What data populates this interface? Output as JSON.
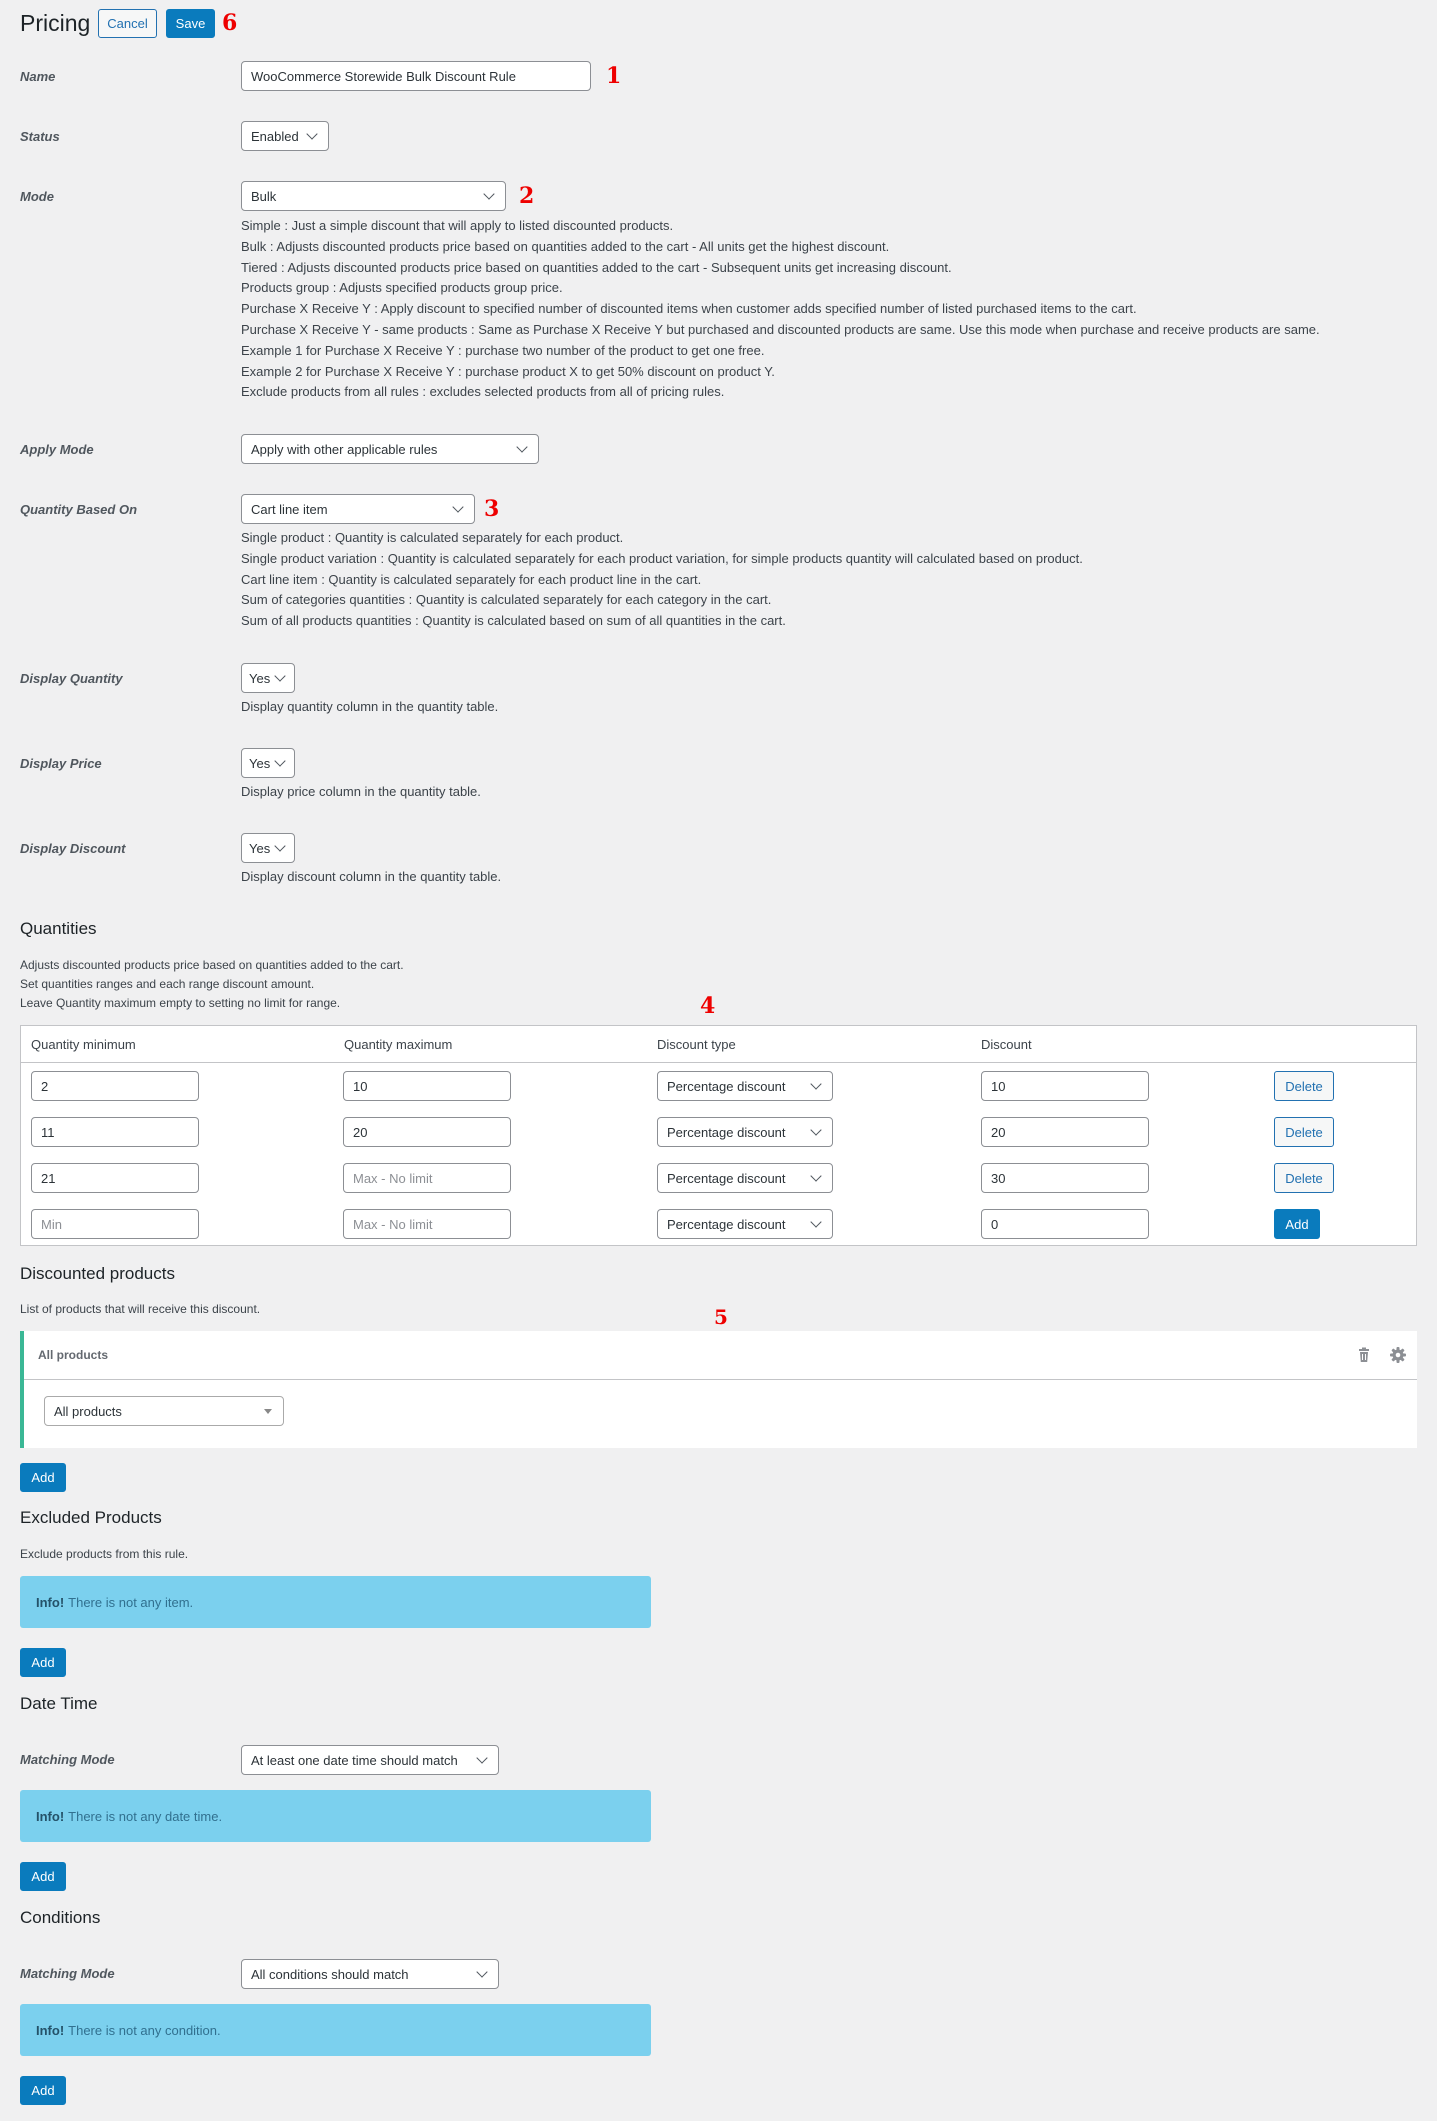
{
  "header": {
    "title": "Pricing",
    "cancel_label": "Cancel",
    "save_label": "Save",
    "annotation": "6"
  },
  "fields": {
    "name": {
      "label": "Name",
      "value": "WooCommerce Storewide Bulk Discount Rule",
      "annotation": "1"
    },
    "status": {
      "label": "Status",
      "value": "Enabled"
    },
    "mode": {
      "label": "Mode",
      "value": "Bulk",
      "annotation": "2",
      "descriptions": [
        "Simple : Just a simple discount that will apply to listed discounted products.",
        "Bulk : Adjusts discounted products price based on quantities added to the cart - All units get the highest discount.",
        "Tiered : Adjusts discounted products price based on quantities added to the cart - Subsequent units get increasing discount.",
        "Products group : Adjusts specified products group price.",
        "Purchase X Receive Y : Apply discount to specified number of discounted items when customer adds specified number of listed purchased items to the cart.",
        "Purchase X Receive Y - same products : Same as Purchase X Receive Y but purchased and discounted products are same. Use this mode when purchase and receive products are same.",
        "Example 1 for Purchase X Receive Y : purchase two number of the product to get one free.",
        "Example 2 for Purchase X Receive Y : purchase product X to get 50% discount on product Y.",
        "Exclude products from all rules : excludes selected products from all of pricing rules."
      ]
    },
    "apply_mode": {
      "label": "Apply Mode",
      "value": "Apply with other applicable rules"
    },
    "quantity_based_on": {
      "label": "Quantity Based On",
      "value": "Cart line item",
      "annotation": "3",
      "descriptions": [
        "Single product : Quantity is calculated separately for each product.",
        "Single product variation : Quantity is calculated separately for each product variation, for simple products quantity will calculated based on product.",
        "Cart line item : Quantity is calculated separately for each product line in the cart.",
        "Sum of categories quantities : Quantity is calculated separately for each category in the cart.",
        "Sum of all products quantities : Quantity is calculated based on sum of all quantities in the cart."
      ]
    },
    "display_quantity": {
      "label": "Display Quantity",
      "value": "Yes",
      "description": "Display quantity column in the quantity table."
    },
    "display_price": {
      "label": "Display Price",
      "value": "Yes",
      "description": "Display price column in the quantity table."
    },
    "display_discount": {
      "label": "Display Discount",
      "value": "Yes",
      "description": "Display discount column in the quantity table."
    }
  },
  "quantities": {
    "title": "Quantities",
    "descriptions": [
      "Adjusts discounted products price based on quantities added to the cart.",
      "Set quantities ranges and each range discount amount.",
      "Leave Quantity maximum empty to setting no limit for range."
    ],
    "annotation": "4",
    "columns": [
      "Quantity minimum",
      "Quantity maximum",
      "Discount type",
      "Discount"
    ],
    "rows": [
      {
        "min": "2",
        "max": "10",
        "type": "Percentage discount",
        "discount": "10",
        "action": "Delete"
      },
      {
        "min": "11",
        "max": "20",
        "type": "Percentage discount",
        "discount": "20",
        "action": "Delete"
      },
      {
        "min": "21",
        "max": "",
        "type": "Percentage discount",
        "discount": "30",
        "action": "Delete"
      }
    ],
    "new_row": {
      "min": "",
      "max": "",
      "type": "Percentage discount",
      "discount": "0",
      "action": "Add"
    },
    "min_placeholder": "Min",
    "max_placeholder": "Max - No limit"
  },
  "discounted_products": {
    "title": "Discounted products",
    "description": "List of products that will receive this discount.",
    "annotation": "5",
    "items": [
      {
        "title": "All products",
        "select_value": "All products"
      }
    ],
    "add_label": "Add"
  },
  "excluded_products": {
    "title": "Excluded Products",
    "description": "Exclude products from this rule.",
    "info_strong": "Info!",
    "info_text": "There is not any item.",
    "add_label": "Add"
  },
  "date_time": {
    "title": "Date Time",
    "matching_label": "Matching Mode",
    "matching_value": "At least one date time should match",
    "info_strong": "Info!",
    "info_text": "There is not any date time.",
    "add_label": "Add"
  },
  "conditions": {
    "title": "Conditions",
    "matching_label": "Matching Mode",
    "matching_value": "All conditions should match",
    "info_strong": "Info!",
    "info_text": "There is not any condition.",
    "add_label": "Add"
  },
  "colors": {
    "primary": "#0a7bbd",
    "info_bg": "#7bd0ee",
    "card_accent": "#3ab795",
    "annotation": "#ee0000"
  }
}
